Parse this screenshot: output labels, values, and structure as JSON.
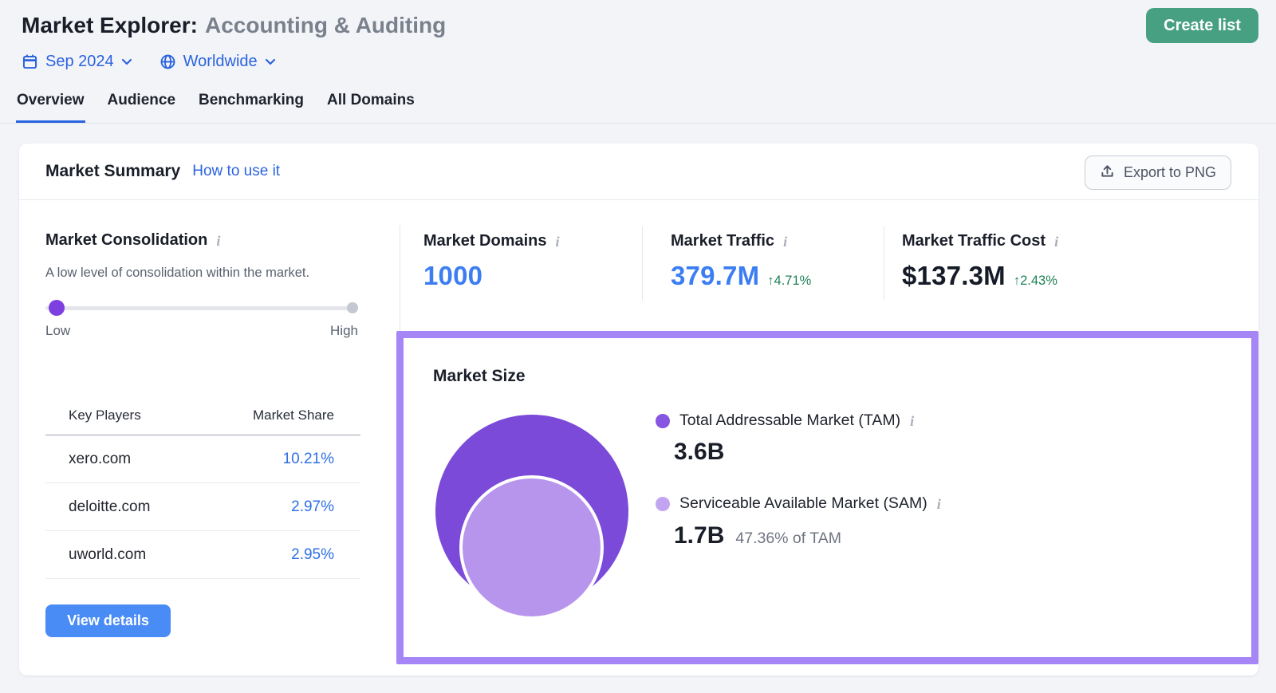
{
  "header": {
    "title_prefix": "Market Explorer:",
    "title_market": "Accounting & Auditing",
    "create_list_label": "Create list",
    "date_filter": "Sep 2024",
    "region_filter": "Worldwide"
  },
  "tabs": [
    {
      "label": "Overview",
      "active": true
    },
    {
      "label": "Audience",
      "active": false
    },
    {
      "label": "Benchmarking",
      "active": false
    },
    {
      "label": "All Domains",
      "active": false
    }
  ],
  "card": {
    "title": "Market Summary",
    "help_link": "How to use it",
    "export_button": "Export to PNG"
  },
  "consolidation": {
    "title": "Market Consolidation",
    "description": "A low level of consolidation within the market.",
    "level": "Low",
    "low_label": "Low",
    "high_label": "High"
  },
  "key_players": {
    "col_players": "Key Players",
    "col_share": "Market Share",
    "rows": [
      {
        "domain": "xero.com",
        "share": "10.21%"
      },
      {
        "domain": "deloitte.com",
        "share": "2.97%"
      },
      {
        "domain": "uworld.com",
        "share": "2.95%"
      }
    ],
    "view_details_label": "View details"
  },
  "stats": [
    {
      "label": "Market Domains",
      "value": "1000",
      "delta": ""
    },
    {
      "label": "Market Traffic",
      "value": "379.7M",
      "delta": "↑4.71%"
    },
    {
      "label": "Market Traffic Cost",
      "value": "$137.3M",
      "delta": "↑2.43%"
    }
  ],
  "market_size": {
    "title": "Market Size",
    "tam": {
      "label": "Total Addressable Market (TAM)",
      "value": "3.6B"
    },
    "sam": {
      "label": "Serviceable Available Market (SAM)",
      "value": "1.7B",
      "share_of_tam": "47.36% of TAM"
    }
  },
  "chart_data": {
    "type": "bubble",
    "title": "Market Size",
    "legend_position": "right",
    "series": [
      {
        "name": "Total Addressable Market (TAM)",
        "value": 3600000000,
        "value_label": "3.6B",
        "color": "#7B4AD8"
      },
      {
        "name": "Serviceable Available Market (SAM)",
        "value": 1700000000,
        "value_label": "1.7B",
        "percent_of_tam": "47.36%",
        "color": "#B795EC"
      }
    ]
  },
  "icons": {
    "calendar-icon": "calendar glyph (blue outline)",
    "globe-icon": "globe glyph (blue outline)",
    "chevron-down-icon": "▾",
    "info-icon": "i",
    "upload-icon": "↥"
  },
  "colors": {
    "accent_blue": "#2B63DF",
    "metric_blue": "#3C7EF2",
    "positive_green": "#1F8057",
    "create_list_green": "#47A081",
    "view_details_blue": "#4A8CF6",
    "highlight_purple_border": "#A685F6",
    "tam_circle": "#7B4AD8",
    "sam_circle": "#B795EC",
    "slider_knob_purple": "#7D3FE0",
    "page_background": "#F3F4F8"
  }
}
